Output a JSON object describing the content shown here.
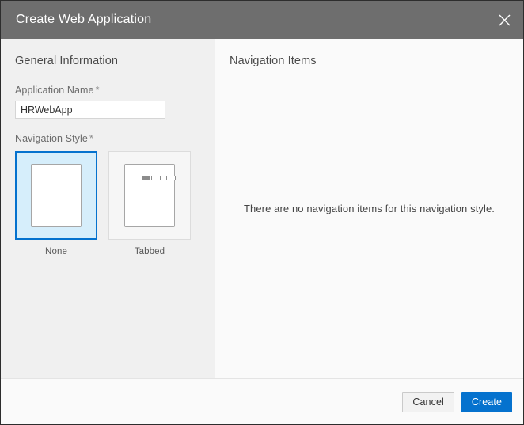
{
  "window": {
    "title": "Create Web Application",
    "close_icon": "close-icon"
  },
  "left_panel": {
    "section_title": "General Information",
    "application_name": {
      "label": "Application Name",
      "required_marker": "*",
      "value": "HRWebApp",
      "placeholder": ""
    },
    "navigation_style": {
      "label": "Navigation Style",
      "required_marker": "*",
      "selected": "None",
      "options": [
        {
          "label": "None",
          "selected": true,
          "preview": "plain-page-icon"
        },
        {
          "label": "Tabbed",
          "selected": false,
          "preview": "tabbed-page-icon",
          "tab_count": 4,
          "active_tab_index": 0
        }
      ]
    }
  },
  "right_panel": {
    "section_title": "Navigation Items",
    "empty_message": "There are no navigation items for this navigation style."
  },
  "footer": {
    "cancel_label": "Cancel",
    "create_label": "Create"
  },
  "colors": {
    "titlebar": "#6e6e6e",
    "accent": "#0572ce",
    "selected_card_fill": "#d6eefb",
    "left_panel_bg": "#f0f0f0",
    "right_panel_bg": "#fafafa",
    "window_border": "#2d2d2d"
  }
}
